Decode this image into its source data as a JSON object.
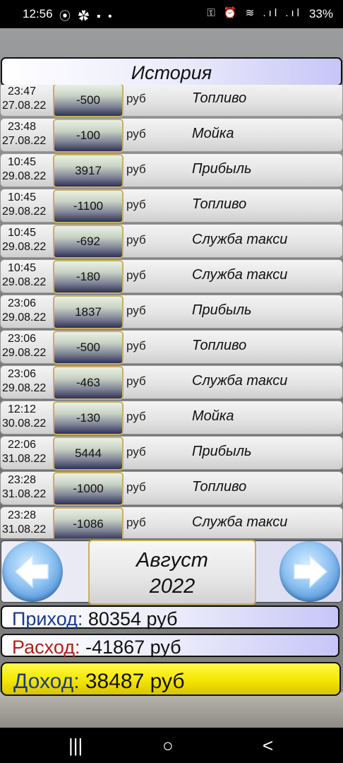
{
  "status_bar": {
    "time": "12:56",
    "left_icons": "⦿ ✿ ▪ •",
    "right_icons": "⚿ ⏰ ≋ .ıl .ıl",
    "battery": "33%"
  },
  "header": {
    "title": "История"
  },
  "transactions": [
    {
      "time": "23:47",
      "date": "27.08.22",
      "amount": "-500",
      "currency": "руб",
      "category": "Топливо"
    },
    {
      "time": "23:48",
      "date": "27.08.22",
      "amount": "-100",
      "currency": "руб",
      "category": "Мойка"
    },
    {
      "time": "10:45",
      "date": "29.08.22",
      "amount": "3917",
      "currency": "руб",
      "category": "Прибыль"
    },
    {
      "time": "10:45",
      "date": "29.08.22",
      "amount": "-1100",
      "currency": "руб",
      "category": "Топливо"
    },
    {
      "time": "10:45",
      "date": "29.08.22",
      "amount": "-692",
      "currency": "руб",
      "category": "Служба такси"
    },
    {
      "time": "10:45",
      "date": "29.08.22",
      "amount": "-180",
      "currency": "руб",
      "category": "Служба такси"
    },
    {
      "time": "23:06",
      "date": "29.08.22",
      "amount": "1837",
      "currency": "руб",
      "category": "Прибыль"
    },
    {
      "time": "23:06",
      "date": "29.08.22",
      "amount": "-500",
      "currency": "руб",
      "category": "Топливо"
    },
    {
      "time": "23:06",
      "date": "29.08.22",
      "amount": "-463",
      "currency": "руб",
      "category": "Служба такси"
    },
    {
      "time": "12:12",
      "date": "30.08.22",
      "amount": "-130",
      "currency": "руб",
      "category": "Мойка"
    },
    {
      "time": "22:06",
      "date": "31.08.22",
      "amount": "5444",
      "currency": "руб",
      "category": "Прибыль"
    },
    {
      "time": "23:28",
      "date": "31.08.22",
      "amount": "-1000",
      "currency": "руб",
      "category": "Топливо"
    },
    {
      "time": "23:28",
      "date": "31.08.22",
      "amount": "-1086",
      "currency": "руб",
      "category": "Служба такси"
    }
  ],
  "period": {
    "month": "Август",
    "year": "2022"
  },
  "summary": {
    "income_label": "Приход:",
    "income_value": "80354 руб",
    "expense_label": "Расход:",
    "expense_value": "-41867 руб",
    "net_label": "Доход:",
    "net_value": "38487 руб"
  },
  "navbar": {
    "recents": "|||",
    "home": "○",
    "back": "<"
  },
  "colors": {
    "accent_purple": "#c7c5f7",
    "net_yellow": "#f4e600",
    "income_blue": "#1a3a8c",
    "expense_red": "#b0201c"
  }
}
